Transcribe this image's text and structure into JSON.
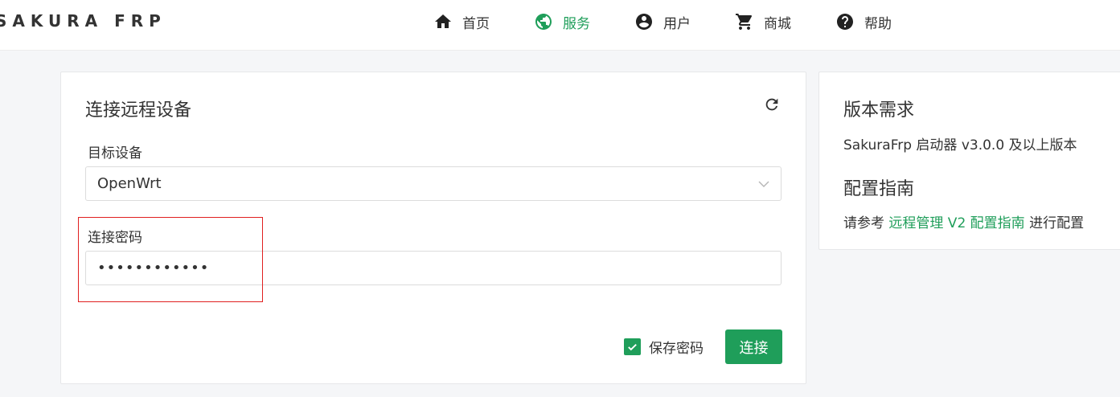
{
  "header": {
    "brand": "SAKURA FRP",
    "nav": [
      {
        "label": "首页",
        "icon": "home-icon"
      },
      {
        "label": "服务",
        "icon": "globe-icon",
        "active": true
      },
      {
        "label": "用户",
        "icon": "user-circle-icon"
      },
      {
        "label": "商城",
        "icon": "cart-icon"
      },
      {
        "label": "帮助",
        "icon": "help-icon"
      }
    ]
  },
  "connect": {
    "title": "连接远程设备",
    "device_label": "目标设备",
    "device_value": "OpenWrt",
    "password_label": "连接密码",
    "password_value": "••••••••••••",
    "save_password_label": "保存密码",
    "save_password_checked": true,
    "connect_button": "连接"
  },
  "side": {
    "version_title": "版本需求",
    "version_text": "SakuraFrp 启动器 v3.0.0 及以上版本",
    "guide_title": "配置指南",
    "guide_prefix": "请参考",
    "guide_link": "远程管理 V2 配置指南",
    "guide_suffix": "进行配置"
  },
  "colors": {
    "accent": "#1f9e5a",
    "highlight": "#e02020"
  }
}
